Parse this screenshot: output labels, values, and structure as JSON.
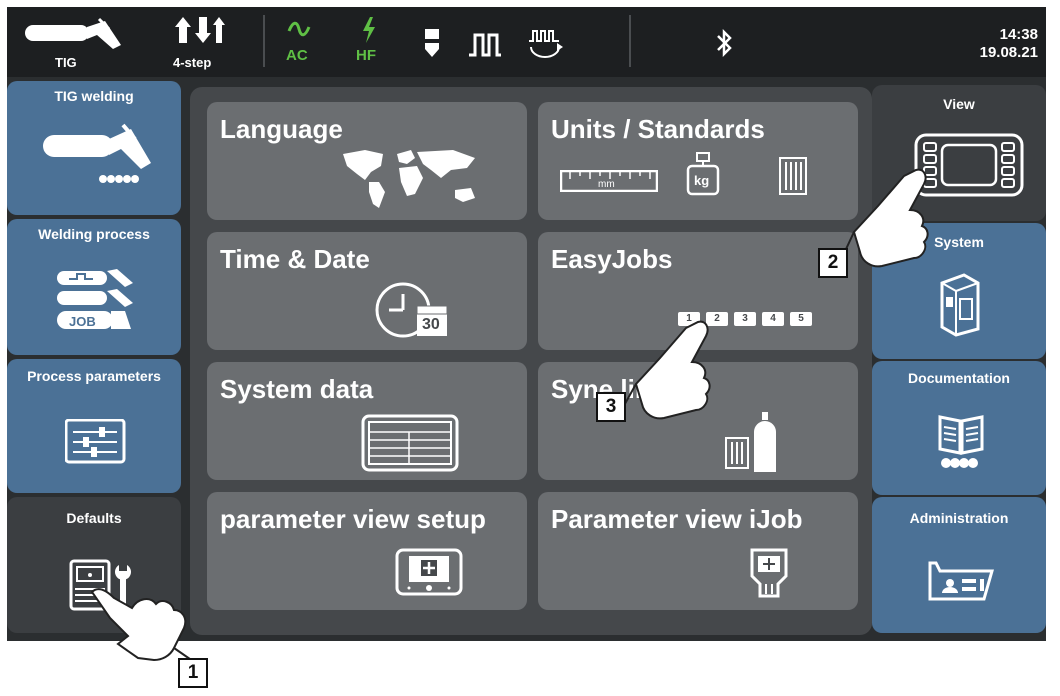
{
  "statusbar": {
    "process_label": "TIG",
    "mode_label": "4-step",
    "ac_label": "AC",
    "hf_label": "HF",
    "time": "14:38",
    "date": "19.08.21"
  },
  "left_nav": [
    {
      "label": "TIG welding"
    },
    {
      "label": "Welding process"
    },
    {
      "label": "Process parameters"
    },
    {
      "label": "Defaults"
    }
  ],
  "right_nav": [
    {
      "label": "View"
    },
    {
      "label": "System"
    },
    {
      "label": "Documentation"
    },
    {
      "label": "Administration"
    }
  ],
  "tiles": [
    {
      "label": "Language"
    },
    {
      "label": "Units / Standards"
    },
    {
      "label": "Time & Date"
    },
    {
      "label": "EasyJobs"
    },
    {
      "label": "System data"
    },
    {
      "label": "Syne lines"
    },
    {
      "label": "parameter view setup"
    },
    {
      "label": "Parameter view iJob"
    }
  ],
  "icons": {
    "ruler_unit": "mm",
    "weight_unit": "kg",
    "job_icon_label": "JOB",
    "calendar_day": "30",
    "easyjob_slots": [
      "1",
      "2",
      "3",
      "4",
      "5"
    ]
  },
  "callouts": [
    "1",
    "2",
    "3"
  ],
  "colors": {
    "status_green": "#5fbf45",
    "tile_blue": "#4b7196",
    "tile_gray": "#6b6e71",
    "panel_dark": "#2b2e30"
  }
}
